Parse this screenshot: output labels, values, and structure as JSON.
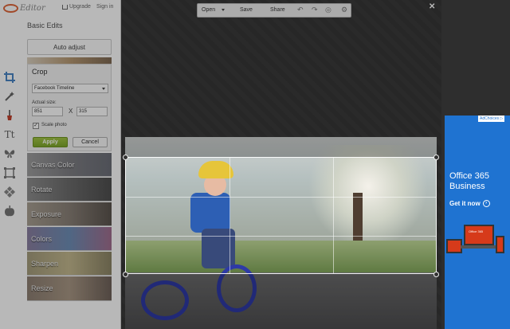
{
  "app": {
    "brand": "Editor",
    "upgrade_label": "Upgrade",
    "signin_label": "Sign in"
  },
  "panel": {
    "section_title": "Basic Edits",
    "auto_adjust_label": "Auto adjust"
  },
  "crop": {
    "title": "Crop",
    "preset_selected": "Facebook Timeline",
    "actual_size_label": "Actual size:",
    "width_value": "851",
    "times_symbol": "X",
    "height_value": "315",
    "scale_photo_label": "Scale photo",
    "scale_photo_checked": "✓",
    "apply_label": "Apply",
    "cancel_label": "Cancel"
  },
  "edits": [
    {
      "label": "Canvas Color"
    },
    {
      "label": "Rotate"
    },
    {
      "label": "Exposure"
    },
    {
      "label": "Colors"
    },
    {
      "label": "Sharpen"
    },
    {
      "label": "Resize"
    }
  ],
  "toolbar": {
    "open_label": "Open",
    "save_label": "Save",
    "share_label": "Share"
  },
  "tools": [
    "crop-icon",
    "magic-wand-icon",
    "brush-icon",
    "text-icon",
    "butterfly-icon",
    "frame-icon",
    "texture-icon",
    "apple-icon"
  ],
  "ad": {
    "adchoices_label": "AdChoices ▷",
    "title": "Office 365 Business",
    "cta_label": "Get it now",
    "laptop_label": "Office 365",
    "colors": {
      "bg": "#1f73d1",
      "accent": "#d63a1a"
    }
  },
  "colors": {
    "apply_green": "#8ab536",
    "workspace": "#3a3a3a"
  }
}
